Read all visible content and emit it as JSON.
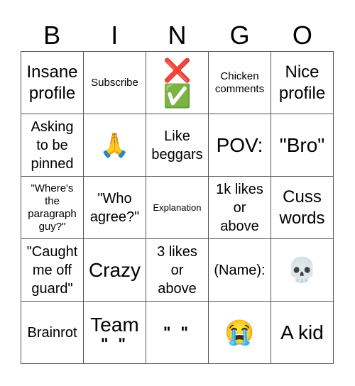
{
  "header": {
    "letters": [
      "B",
      "I",
      "N",
      "G",
      "O"
    ]
  },
  "cells": [
    [
      "Insane\nprofile",
      "Subscribe",
      "❌\n✅",
      "Chicken\ncomments",
      "Nice\nprofile"
    ],
    [
      "Asking\nto be\npinned",
      "🙏",
      "Like\nbeggars",
      "POV:",
      "\"Bro\""
    ],
    [
      "\"Where's\nthe\nparagraph\nguy?\"",
      "\"Who\nagree?\"",
      "Explanation",
      "1k likes\nor\nabove",
      "Cuss\nwords"
    ],
    [
      "\"Caught\nme off\nguard\"",
      "Crazy",
      "3 likes\nor\nabove",
      "(Name):",
      "💀"
    ],
    [
      "Brainrot",
      "Team",
      "\" \"",
      "😭",
      "A kid"
    ]
  ],
  "team_cell_suffix": "\" \""
}
